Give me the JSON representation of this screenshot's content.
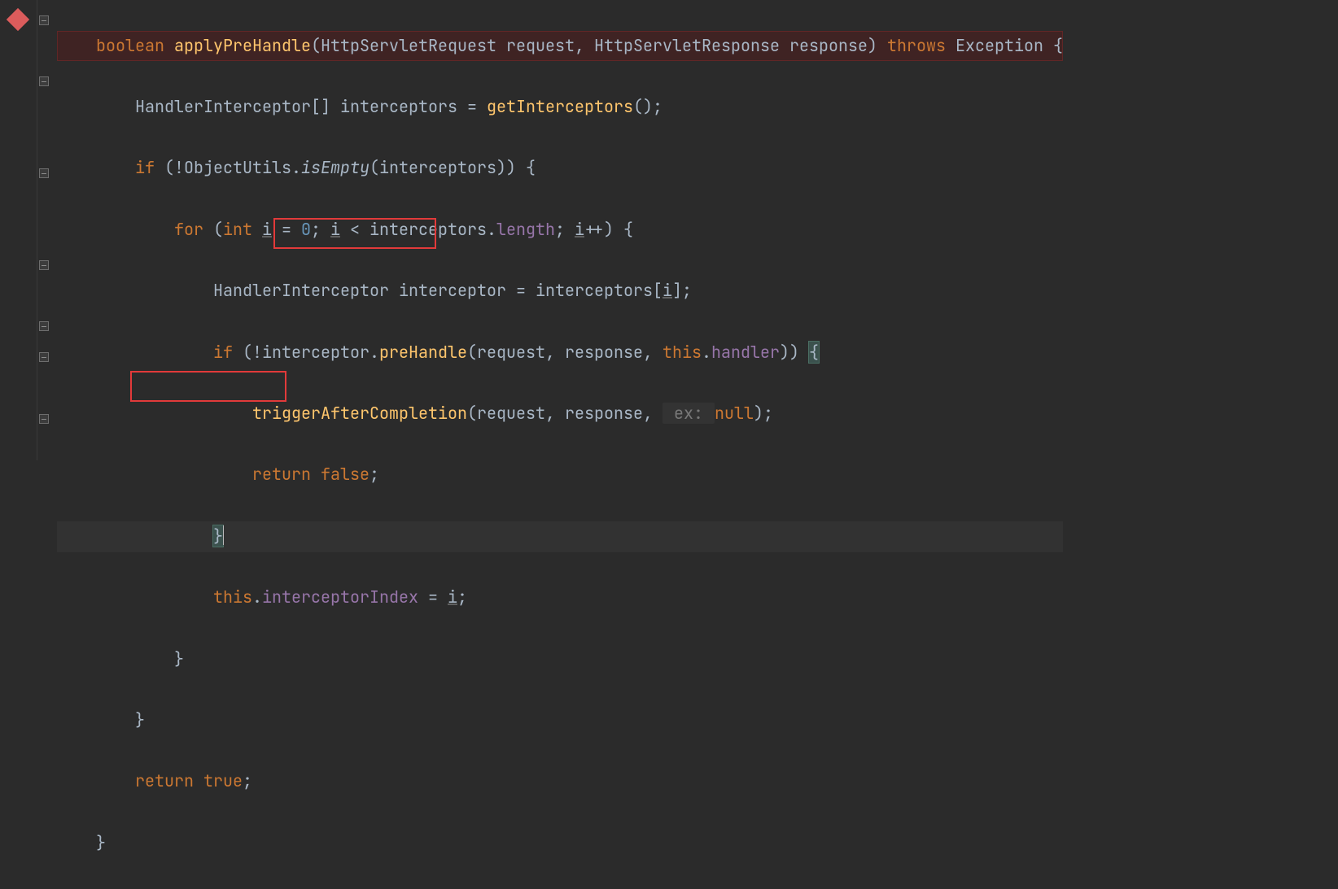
{
  "code": {
    "l1": {
      "kw1": "boolean",
      "fn": "applyPreHandle",
      "p1": "(HttpServletRequest request, HttpServletResponse response) ",
      "kw2": "throws",
      "exc": " Exception ",
      "br": "{"
    },
    "l2": {
      "t1": "HandlerInterceptor[] interceptors = ",
      "fn": "getInterceptors",
      "t2": "();"
    },
    "l3": {
      "kw": "if",
      "t1": " (!ObjectUtils.",
      "m": "isEmpty",
      "t2": "(interceptors)) {"
    },
    "l4": {
      "kw": "for",
      "t1": " (",
      "kw2": "int",
      "t2": " ",
      "v": "i",
      "t3": " = ",
      "n": "0",
      "t4": "; ",
      "v2": "i",
      "t5": " < interceptors.",
      "p": "length",
      "t6": "; ",
      "v3": "i",
      "t7": "++) {"
    },
    "l5": {
      "t1": "HandlerInterceptor interceptor = interceptors[",
      "v": "i",
      "t2": "];"
    },
    "l6": {
      "kw": "if",
      "t1": " (!interceptor.",
      "fn": "preHandle",
      "t2": "(request, response, ",
      "kw2": "this",
      "t3": ".",
      "p": "handler",
      "t4": ")) ",
      "br": "{"
    },
    "l7": {
      "fn": "triggerAfterCompletion",
      "t1": "(request, response, ",
      "hint": " ex: ",
      "kw": "null",
      "t2": ");"
    },
    "l8": {
      "kw": "return false",
      "t": ";"
    },
    "l9": {
      "br": "}"
    },
    "l10": {
      "kw": "this",
      "t1": ".",
      "p": "interceptorIndex",
      "t2": " = ",
      "v": "i",
      "t3": ";"
    },
    "l11": {
      "br": "}"
    },
    "l12": {
      "br": "}"
    },
    "l13": {
      "kw": "return true",
      "t": ";"
    },
    "l14": {
      "br": "}"
    }
  },
  "indent": {
    "i1": "    ",
    "i2": "        ",
    "i3": "            ",
    "i4": "                ",
    "i5": "                    ",
    "i6": "                        "
  }
}
